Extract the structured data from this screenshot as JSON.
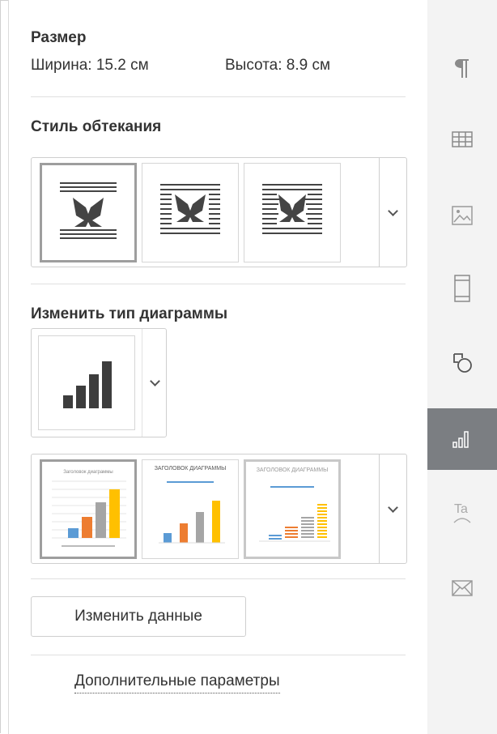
{
  "size": {
    "title": "Размер",
    "width_label": "Ширина: 15.2 см",
    "height_label": "Высота: 8.9 см"
  },
  "wrap": {
    "title": "Стиль обтекания",
    "options": [
      "inline-wrap-icon",
      "square-wrap-icon",
      "tight-wrap-icon"
    ],
    "selected_index": 0
  },
  "chart_type": {
    "title": "Изменить тип диаграммы",
    "current_icon": "bar-chart-icon"
  },
  "chart_styles": {
    "thumbs": [
      {
        "title": "Заголовок диаграммы"
      },
      {
        "title": "ЗАГОЛОВОК ДИАГРАММЫ"
      },
      {
        "title": "ЗАГОЛОВОК ДИАГРАММЫ"
      }
    ],
    "selected_index": 0
  },
  "buttons": {
    "edit_data": "Изменить данные"
  },
  "links": {
    "advanced": "Дополнительные параметры"
  },
  "rail": {
    "items": [
      "paragraph-icon",
      "table-icon",
      "image-icon",
      "header-footer-icon",
      "shape-icon",
      "chart-icon",
      "text-art-icon",
      "mail-merge-icon"
    ],
    "active_index": 5
  },
  "colors": {
    "accent_active": "#7b7e82",
    "bar_blue": "#5b9bd5",
    "bar_orange": "#ed7d31",
    "bar_gray": "#a5a5a5",
    "bar_yellow": "#ffc000"
  }
}
